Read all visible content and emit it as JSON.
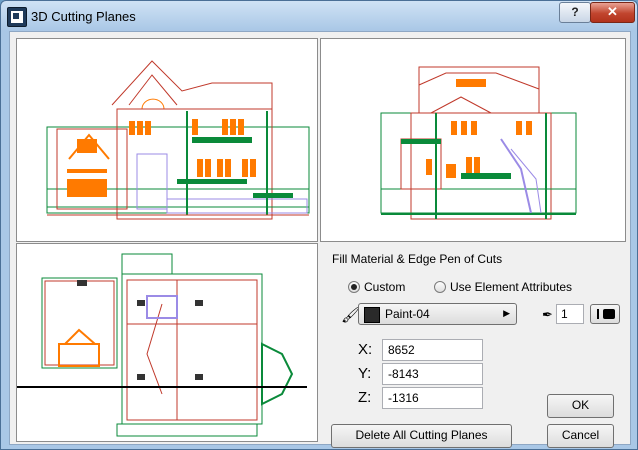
{
  "window": {
    "title": "3D Cutting Planes"
  },
  "titlebar": {
    "help_label": "?",
    "close_label": "✕"
  },
  "fill_section": {
    "heading": "Fill Material & Edge Pen of Cuts",
    "radio_custom": "Custom",
    "radio_element": "Use Element Attributes",
    "selected": "Custom",
    "material": "Paint-04",
    "material_color": "#2a2a2a",
    "pen_number": "1"
  },
  "coords": {
    "x_label": "X:",
    "x_value": "8652",
    "y_label": "Y:",
    "y_value": "-8143",
    "z_label": "Z:",
    "z_value": "-1316"
  },
  "buttons": {
    "ok": "OK",
    "cancel": "Cancel",
    "delete_all": "Delete All Cutting Planes"
  },
  "colors": {
    "drawing_red": "#c0392b",
    "drawing_green": "#0a8a3a",
    "drawing_orange": "#ff7a00",
    "drawing_purple": "#9b8be6"
  }
}
